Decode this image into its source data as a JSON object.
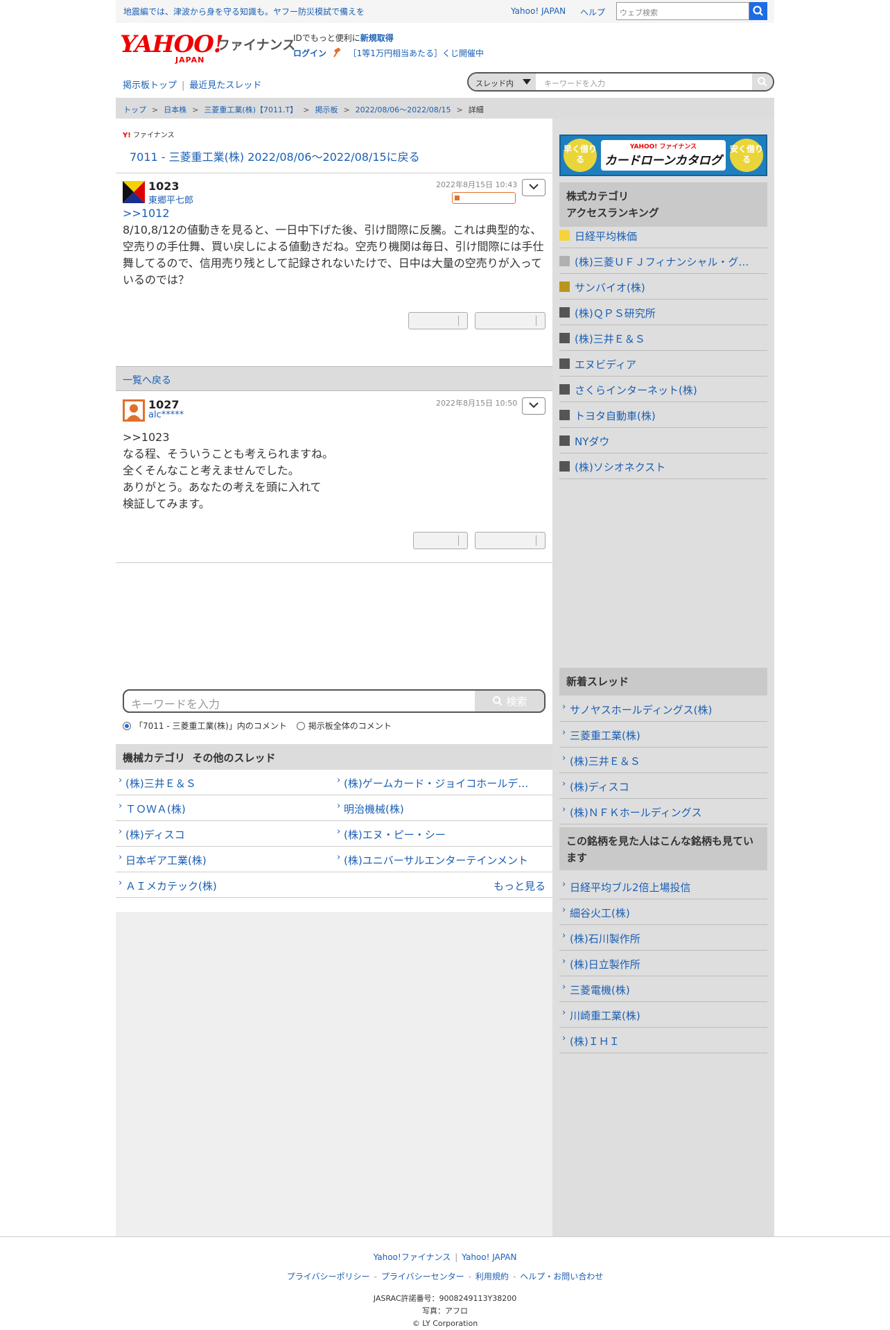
{
  "topbar": {
    "notice": "地震編では、津波から身を守る知識も。ヤフー防災模試で備えを",
    "yahoo_japan": "Yahoo! JAPAN",
    "help": "ヘルプ",
    "web_search_placeholder": "ウェブ検索"
  },
  "header": {
    "logo_yahoo": "YAHOO!",
    "logo_japan": "JAPAN",
    "logo_finance": "ファイナンス",
    "id_text": "IDでもっと便利に",
    "id_signup": "新規取得",
    "login": "ログイン",
    "lottery": "［1等1万円相当あたる］くじ開催中"
  },
  "nav": {
    "board_top": "掲示板トップ",
    "recent_threads": "最近見たスレッド",
    "search_scope": "スレッド内",
    "search_placeholder": "キーワードを入力"
  },
  "breadcrumb": [
    "トップ",
    "日本株",
    "三菱重工業(株)【7011.T】",
    "掲示板",
    "2022/08/06〜2022/08/15",
    "詳細"
  ],
  "thread": {
    "brand_small": "ファイナンス",
    "back_link": "7011 - 三菱重工業(株) 2022/08/06〜2022/08/15に戻る"
  },
  "posts": [
    {
      "number": "1023",
      "user": "東郷平七郎",
      "date": "2022年8月15日 10:43",
      "reply_to": ">>1012",
      "body": "8/10,8/12の値動きを見ると、一日中下げた後、引け間際に反騰。これは典型的な、空売りの手仕舞、買い戻しによる値動きだね。空売り機関は毎日、引け間際には手仕舞してるので、信用売り残として記録されないたけで、日中は大量の空売りが入っているのでは？"
    },
    {
      "number": "1027",
      "user": "alc*****",
      "date": "2022年8月15日 10:50",
      "body_lines": [
        ">>1023",
        "なる程、そういうことも考えられますね。",
        "全くそんなこと考えませんでした。",
        "ありがとう。あなたの考えを頭に入れて",
        "検証してみます。"
      ]
    }
  ],
  "back_to_list": "一覧へ戻る",
  "keyword_search": {
    "placeholder": "キーワードを入力",
    "button": "検索",
    "scope_thread": "「7011 - 三菱重工業(株)」内のコメント",
    "scope_all": "掲示板全体のコメント"
  },
  "other_threads": {
    "heading": "機械カテゴリ  その他のスレッド",
    "items": [
      "(株)三井Ｅ＆Ｓ",
      "(株)ゲームカード・ジョイコホールデ…",
      "ＴＯＷＡ(株)",
      "明治機械(株)",
      "(株)ディスコ",
      "(株)エヌ・ピー・シー",
      "日本ギア工業(株)",
      "(株)ユニバーサルエンターテインメント",
      "ＡＩメカテック(株)"
    ],
    "more": "もっと見る"
  },
  "sidebar": {
    "ad": {
      "left": "早く借りる",
      "brand": "YAHOO! ファイナンス",
      "title": "カードローンカタログ",
      "right": "安く借りる"
    },
    "ranking_heading": "株式カテゴリ\nアクセスランキング",
    "ranking": [
      {
        "label": "日経平均株価",
        "color": "#f5d33a"
      },
      {
        "label": "(株)三菱ＵＦＪフィナンシャル・グ…",
        "color": "#b0b0b0"
      },
      {
        "label": "サンバイオ(株)",
        "color": "#b8961e"
      },
      {
        "label": "(株)ＱＰＳ研究所",
        "color": "#555555"
      },
      {
        "label": "(株)三井Ｅ＆Ｓ",
        "color": "#555555"
      },
      {
        "label": "エヌビディア",
        "color": "#555555"
      },
      {
        "label": "さくらインターネット(株)",
        "color": "#555555"
      },
      {
        "label": "トヨタ自動車(株)",
        "color": "#555555"
      },
      {
        "label": "NYダウ",
        "color": "#555555"
      },
      {
        "label": "(株)ソシオネクスト",
        "color": "#555555"
      }
    ],
    "new_threads_heading": "新着スレッド",
    "new_threads": [
      "サノヤスホールディングス(株)",
      "三菱重工業(株)",
      "(株)三井Ｅ＆Ｓ",
      "(株)ディスコ",
      "(株)ＮＦＫホールディングス"
    ],
    "also_viewed_heading": "この銘柄を見た人はこんな銘柄も見ています",
    "also_viewed": [
      "日経平均ブル2倍上場投信",
      "細谷火工(株)",
      "(株)石川製作所",
      "(株)日立製作所",
      "三菱電機(株)",
      "川崎重工業(株)",
      "(株)ＩＨＩ"
    ]
  },
  "footer": {
    "links1": [
      "Yahoo!ファイナンス",
      "Yahoo! JAPAN"
    ],
    "links2": [
      "プライバシーポリシー",
      "プライバシーセンター",
      "利用規約",
      "ヘルプ・お問い合わせ"
    ],
    "jasrac": "JASRAC許諾番号：9008249113Y38200",
    "photo": "写真：アフロ",
    "copyright": "© LY Corporation"
  }
}
